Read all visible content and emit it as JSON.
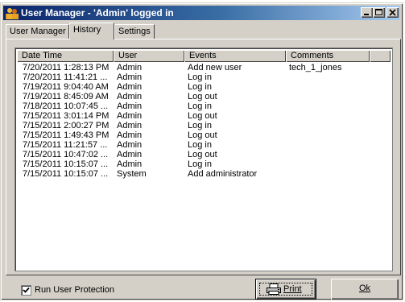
{
  "window": {
    "title": "User Manager - 'Admin' logged in",
    "accent": "#0a246a"
  },
  "titlebar_buttons": [
    "minimize-icon",
    "maximize-icon",
    "close-icon"
  ],
  "tabs": [
    {
      "label": "User Manager",
      "active": false
    },
    {
      "label": "History",
      "active": true
    },
    {
      "label": "Settings",
      "active": false
    }
  ],
  "history": {
    "columns": [
      "Date Time",
      "User",
      "Events",
      "Comments"
    ],
    "rows": [
      {
        "date": "7/20/2011 1:28:13 PM",
        "user": "Admin",
        "event": "Add new user",
        "comment": "tech_1_jones"
      },
      {
        "date": "7/20/2011 11:41:21 ...",
        "user": "Admin",
        "event": "Log in",
        "comment": ""
      },
      {
        "date": "7/19/2011 9:04:40 AM",
        "user": "Admin",
        "event": "Log in",
        "comment": ""
      },
      {
        "date": "7/19/2011 8:45:09 AM",
        "user": "Admin",
        "event": "Log out",
        "comment": ""
      },
      {
        "date": "7/18/2011 10:07:45 ...",
        "user": "Admin",
        "event": "Log in",
        "comment": ""
      },
      {
        "date": "7/15/2011 3:01:14 PM",
        "user": "Admin",
        "event": "Log out",
        "comment": ""
      },
      {
        "date": "7/15/2011 2:00:27 PM",
        "user": "Admin",
        "event": "Log in",
        "comment": ""
      },
      {
        "date": "7/15/2011 1:49:43 PM",
        "user": "Admin",
        "event": "Log out",
        "comment": ""
      },
      {
        "date": "7/15/2011 11:21:57 ...",
        "user": "Admin",
        "event": "Log in",
        "comment": ""
      },
      {
        "date": "7/15/2011 10:47:02 ...",
        "user": "Admin",
        "event": "Log out",
        "comment": ""
      },
      {
        "date": "7/15/2011 10:15:07 ...",
        "user": "Admin",
        "event": "Log in",
        "comment": ""
      },
      {
        "date": "7/15/2011 10:15:07 ...",
        "user": "System",
        "event": "Add administrator",
        "comment": ""
      }
    ]
  },
  "footer": {
    "protection_label": "Run User Protection",
    "protection_checked": true,
    "print_label": "Print",
    "print_icon": "printer-icon",
    "ok_label": "Ok"
  }
}
